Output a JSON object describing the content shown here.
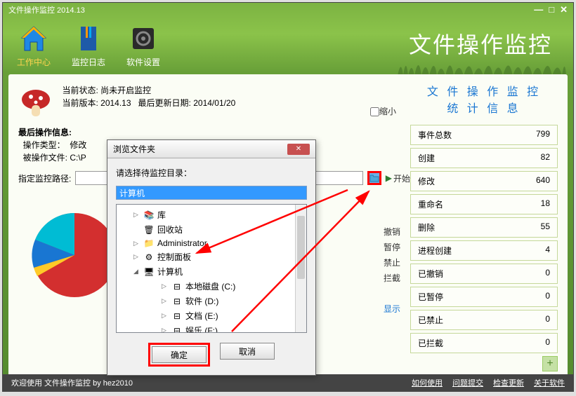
{
  "titlebar": {
    "text": "文件操作监控 2014.13"
  },
  "nav": {
    "work": "工作中心",
    "log": "监控日志",
    "settings": "软件设置"
  },
  "app_title": "文件操作监控",
  "status": {
    "current_label": "当前状态:",
    "current_value": "尚未开启监控",
    "version_label": "当前版本:",
    "version_value": "2014.13",
    "update_label": "最后更新日期:",
    "update_value": "2014/01/20"
  },
  "minimize_label": "缩小",
  "last_op": {
    "title": "最后操作信息:",
    "type_label": "操作类型：",
    "type_value": "修改",
    "file_label": "被操作文件:",
    "file_value": "C:\\P"
  },
  "path": {
    "label": "指定监控路径:",
    "value": "",
    "start": "开始"
  },
  "actions": {
    "undo": "撤销",
    "pause": "暂停",
    "forbid": "禁止",
    "block": "拦截",
    "show": "显示"
  },
  "stats": {
    "title1": "文 件 操 作 监 控",
    "title2": "统 计 信 息",
    "rows": [
      {
        "label": "事件总数",
        "value": "799"
      },
      {
        "label": "创建",
        "value": "82"
      },
      {
        "label": "修改",
        "value": "640"
      },
      {
        "label": "重命名",
        "value": "18"
      },
      {
        "label": "删除",
        "value": "55"
      },
      {
        "label": "进程创建",
        "value": "4"
      },
      {
        "label": "已撤销",
        "value": "0"
      },
      {
        "label": "已暂停",
        "value": "0"
      },
      {
        "label": "已禁止",
        "value": "0"
      },
      {
        "label": "已拦截",
        "value": "0"
      }
    ]
  },
  "footer": {
    "welcome": "欢迎使用 文件操作监控 by hez2010",
    "links": {
      "howto": "如何使用",
      "feedback": "问题提交",
      "update": "检查更新",
      "about": "关于软件"
    }
  },
  "dialog": {
    "title": "浏览文件夹",
    "prompt": "请选择待监控目录：",
    "input": "计算机",
    "tree": {
      "lib": "库",
      "recycle": "回收站",
      "admin": "Administrator",
      "cpanel": "控制面板",
      "computer": "计算机",
      "drive_c": "本地磁盘 (C:)",
      "drive_d": "软件 (D:)",
      "drive_e": "文档 (E:)",
      "drive_f": "娱乐 (F:)"
    },
    "ok": "确定",
    "cancel": "取消"
  },
  "chart_data": {
    "type": "pie",
    "title": "",
    "series": [
      {
        "name": "修改",
        "value": 640,
        "color": "#d32f2f"
      },
      {
        "name": "创建",
        "value": 82,
        "color": "#00bcd4"
      },
      {
        "name": "删除",
        "value": 55,
        "color": "#1976d2"
      },
      {
        "name": "重命名",
        "value": 18,
        "color": "#ffca28"
      },
      {
        "name": "进程创建",
        "value": 4,
        "color": "#7cb342"
      }
    ]
  }
}
